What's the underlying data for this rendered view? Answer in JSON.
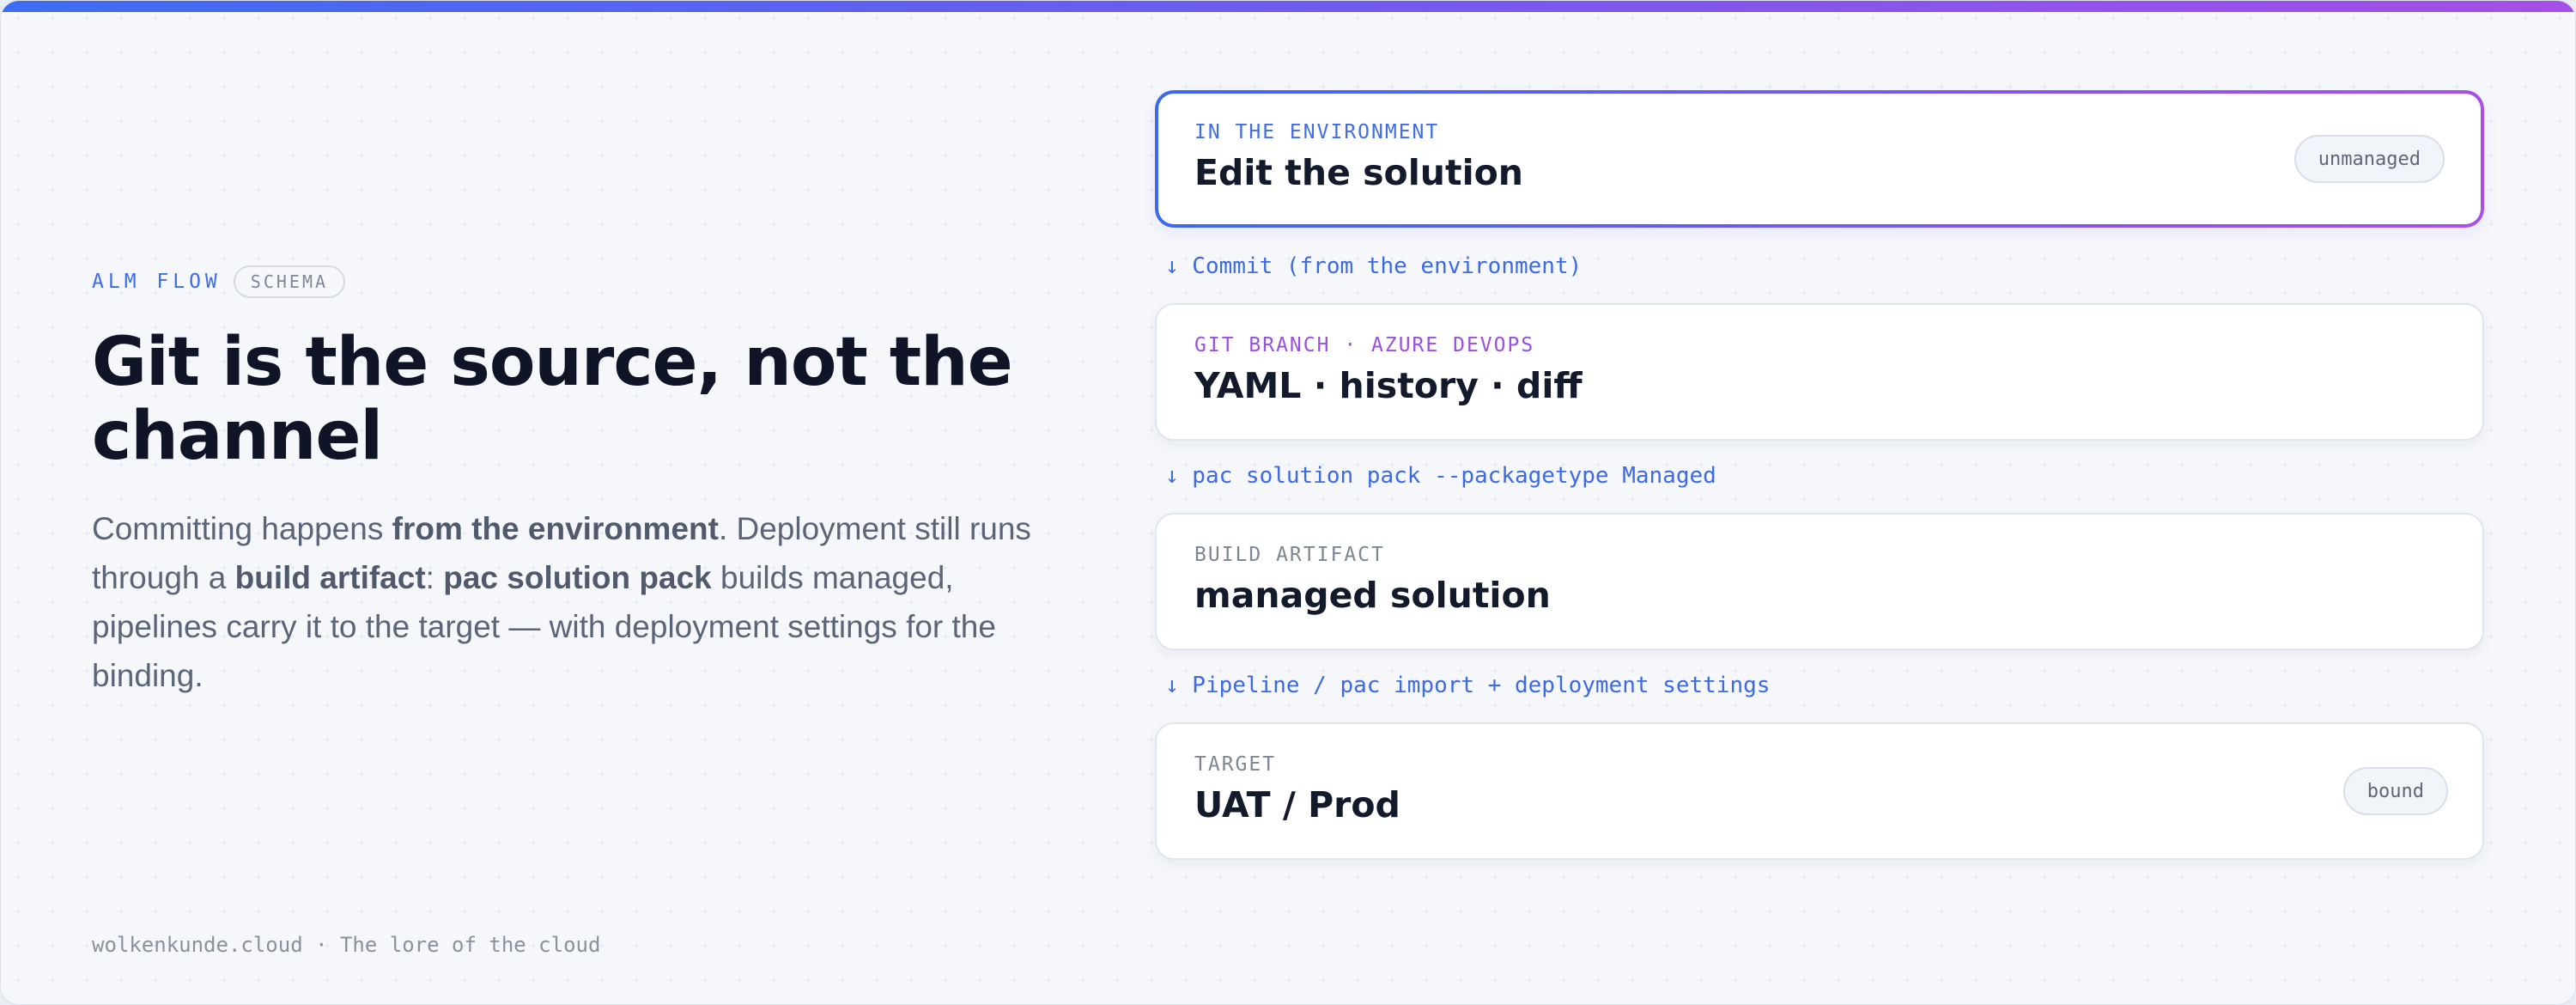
{
  "left": {
    "eyebrow": "ALM FLOW",
    "tag": "SCHEMA",
    "headline": "Git is the source, not the channel",
    "body": {
      "p1": "Committing happens ",
      "b1": "from the environment",
      "p2": ". Deployment still runs through a ",
      "b2": "build artifact",
      "p3": ": ",
      "b3": "pac solution pack",
      "p4": " builds managed, pipelines carry it to the target — with deployment settings for the binding."
    }
  },
  "flow": {
    "steps": [
      {
        "label": "IN THE ENVIRONMENT",
        "title": "Edit the solution",
        "badge": "unmanaged"
      },
      {
        "label": "GIT BRANCH · AZURE DEVOPS",
        "title": "YAML · history · diff"
      },
      {
        "label": "BUILD ARTIFACT",
        "title": "managed solution"
      },
      {
        "label": "TARGET",
        "title": "UAT / Prod",
        "badge": "bound"
      }
    ],
    "connectors": [
      "↓ Commit (from the environment)",
      "↓ pac solution pack --packagetype Managed",
      "↓ Pipeline / pac import + deployment settings"
    ]
  },
  "footer": "wolkenkunde.cloud · The lore of the cloud",
  "colors": {
    "accent_blue": "#3f6de8",
    "accent_purple": "#9a4fe0",
    "headline": "#0f1526"
  }
}
